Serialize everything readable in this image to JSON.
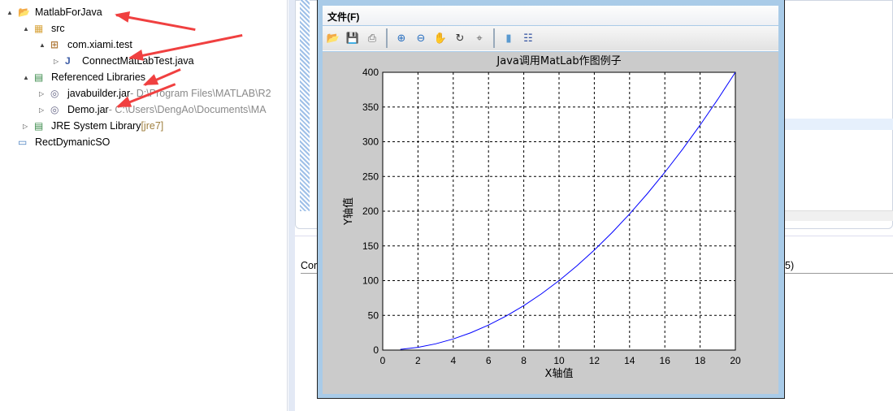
{
  "explorer": {
    "items": [
      {
        "label": "MatlabForJava",
        "twisty": "▲",
        "icon": "project-open-icon"
      },
      {
        "label": "src",
        "twisty": "▲",
        "icon": "source-folder-icon"
      },
      {
        "label": "com.xiami.test",
        "twisty": "▲",
        "icon": "package-icon"
      },
      {
        "label": "ConnectMatLabTest.java",
        "twisty": "▷",
        "icon": "java-file-icon"
      },
      {
        "label": "Referenced Libraries",
        "twisty": "▲",
        "icon": "library-icon"
      },
      {
        "label": "javabuilder.jar",
        "suffix": " - D:\\Program Files\\MATLAB\\R2",
        "twisty": "▷",
        "icon": "jar-icon"
      },
      {
        "label": "Demo.jar",
        "suffix": " - C:\\Users\\DengAo\\Documents\\MA",
        "twisty": "▷",
        "icon": "jar-icon"
      },
      {
        "label": "JRE System Library",
        "suffix": " [jre7]",
        "twisty": "▷",
        "icon": "library-icon"
      },
      {
        "label": "RectDymanicSO",
        "twisty": "",
        "icon": "project-closed-icon"
      }
    ]
  },
  "bottom_panel": {
    "tab_label": "Cor",
    "tail_text": "5)"
  },
  "figure": {
    "menu": {
      "file": "文件(F)"
    },
    "toolbar": [
      "open-icon",
      "save-icon",
      "print-icon",
      "zoom-in-icon",
      "zoom-out-icon",
      "pan-icon",
      "rotate-icon",
      "data-cursor-icon",
      "colorbar-icon",
      "legend-icon"
    ]
  },
  "colors": {
    "line": "#0000ff",
    "arrow": "#f04040",
    "plot_bg": "#cbcbcb"
  },
  "chart_data": {
    "type": "line",
    "title": "Java调用MatLab作图例子",
    "xlabel": "X轴值",
    "ylabel": "Y轴值",
    "xlim": [
      0,
      20
    ],
    "ylim": [
      0,
      400
    ],
    "xticks": [
      0,
      2,
      4,
      6,
      8,
      10,
      12,
      14,
      16,
      18,
      20
    ],
    "yticks": [
      0,
      50,
      100,
      150,
      200,
      250,
      300,
      350,
      400
    ],
    "grid": true,
    "series": [
      {
        "x": [
          1,
          2,
          3,
          4,
          5,
          6,
          7,
          8,
          9,
          10,
          11,
          12,
          13,
          14,
          15,
          16,
          17,
          18,
          19,
          20
        ],
        "y": [
          1,
          4,
          9,
          16,
          25,
          36,
          49,
          64,
          81,
          100,
          121,
          144,
          169,
          196,
          225,
          256,
          289,
          324,
          361,
          400
        ]
      }
    ]
  }
}
